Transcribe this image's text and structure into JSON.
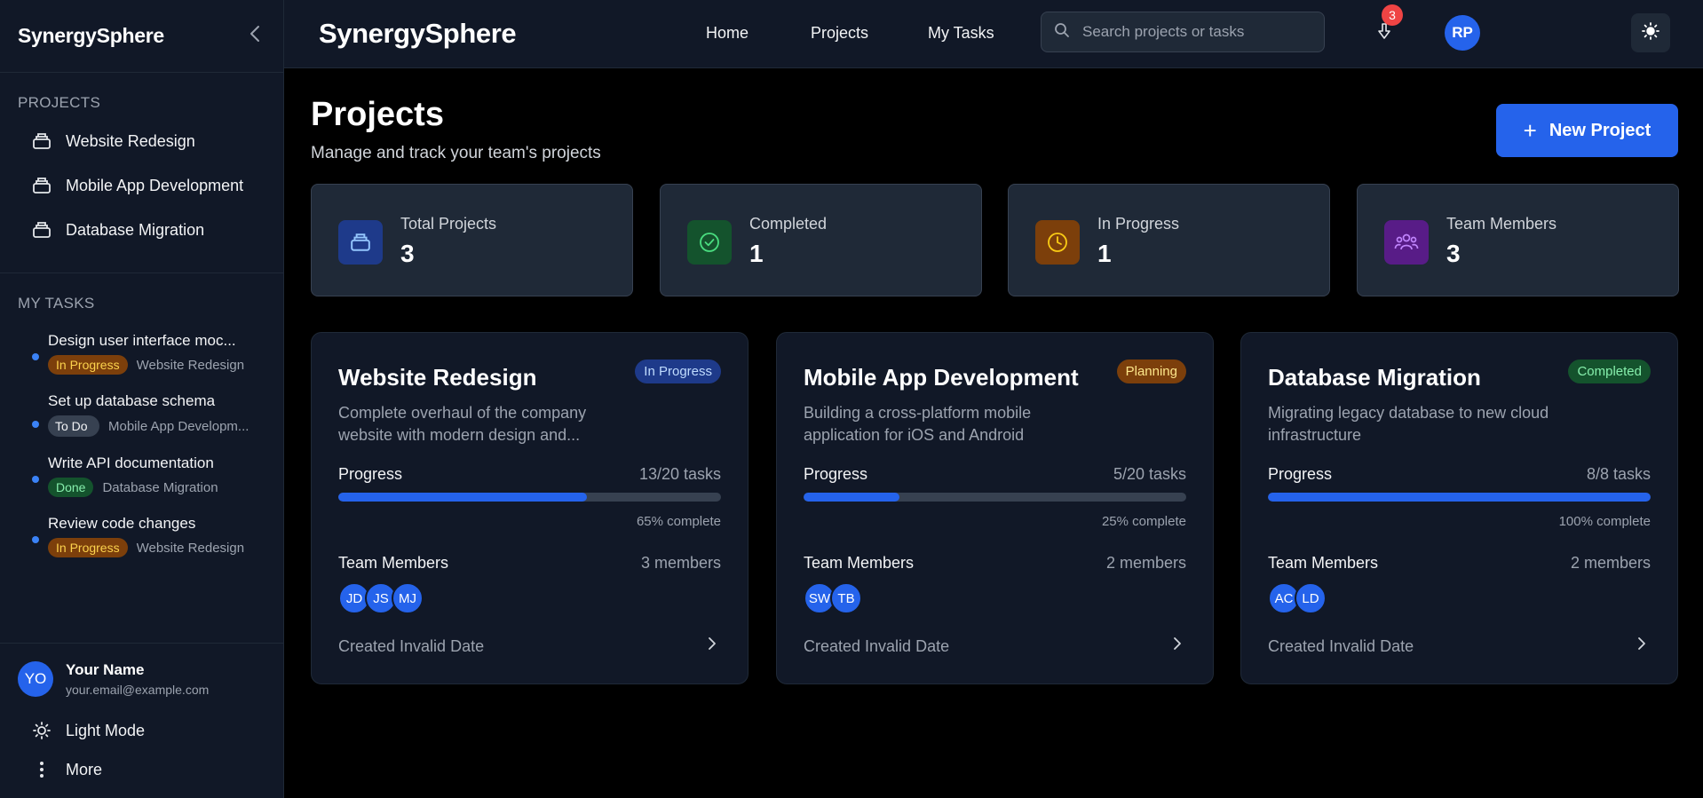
{
  "sidebar": {
    "brand": "SynergySphere",
    "collapse_icon": "chevron-left-icon",
    "projects_title": "PROJECTS",
    "projects": [
      {
        "label": "Website Redesign",
        "icon": "folder-icon"
      },
      {
        "label": "Mobile App Development",
        "icon": "folder-icon"
      },
      {
        "label": "Database Migration",
        "icon": "folder-icon"
      }
    ],
    "tasks_title": "MY TASKS",
    "tasks": [
      {
        "title": "Design user interface moc...",
        "status": "In Progress",
        "project": "Website Redesign"
      },
      {
        "title": "Set up database schema",
        "status": "To Do",
        "project": "Mobile App Developm..."
      },
      {
        "title": "Write API documentation",
        "status": "Done",
        "project": "Database Migration"
      },
      {
        "title": "Review code changes",
        "status": "In Progress",
        "project": "Website Redesign"
      }
    ],
    "user": {
      "initials": "YO",
      "name": "Your Name",
      "email": "your.email@example.com"
    },
    "light_mode_label": "Light Mode",
    "more_label": "More"
  },
  "topbar": {
    "brand": "SynergySphere",
    "nav": [
      "Home",
      "Projects",
      "My Tasks"
    ],
    "search_placeholder": "Search projects or tasks",
    "notification_count": "3",
    "avatar_initials": "RP"
  },
  "main": {
    "title": "Projects",
    "subtitle": "Manage and track your team's projects",
    "new_button": "New Project",
    "stats": [
      {
        "label": "Total Projects",
        "value": "3",
        "icon": "folder-icon",
        "color": "#1e3a8a"
      },
      {
        "label": "Completed",
        "value": "1",
        "icon": "check-circle-icon",
        "color": "#14532d"
      },
      {
        "label": "In Progress",
        "value": "1",
        "icon": "clock-icon",
        "color": "#7c3f0b"
      },
      {
        "label": "Team Members",
        "value": "3",
        "icon": "users-icon",
        "color": "#581c87"
      }
    ],
    "cards": [
      {
        "title": "Website Redesign",
        "status": "In Progress",
        "description": "Complete overhaul of the company website with modern design and...",
        "progress_label": "Progress",
        "tasks": "13/20 tasks",
        "progress": 65,
        "percent": "65% complete",
        "team_label": "Team Members",
        "members_count": "3 members",
        "members": [
          "JD",
          "JS",
          "MJ"
        ],
        "created": "Created Invalid Date"
      },
      {
        "title": "Mobile App Development",
        "status": "Planning",
        "description": "Building a cross-platform mobile application for iOS and Android",
        "progress_label": "Progress",
        "tasks": "5/20 tasks",
        "progress": 25,
        "percent": "25% complete",
        "team_label": "Team Members",
        "members_count": "2 members",
        "members": [
          "SW",
          "TB"
        ],
        "created": "Created Invalid Date"
      },
      {
        "title": "Database Migration",
        "status": "Completed",
        "description": "Migrating legacy database to new cloud infrastructure",
        "progress_label": "Progress",
        "tasks": "8/8 tasks",
        "progress": 100,
        "percent": "100% complete",
        "team_label": "Team Members",
        "members_count": "2 members",
        "members": [
          "AC",
          "LD"
        ],
        "created": "Created Invalid Date"
      }
    ]
  }
}
